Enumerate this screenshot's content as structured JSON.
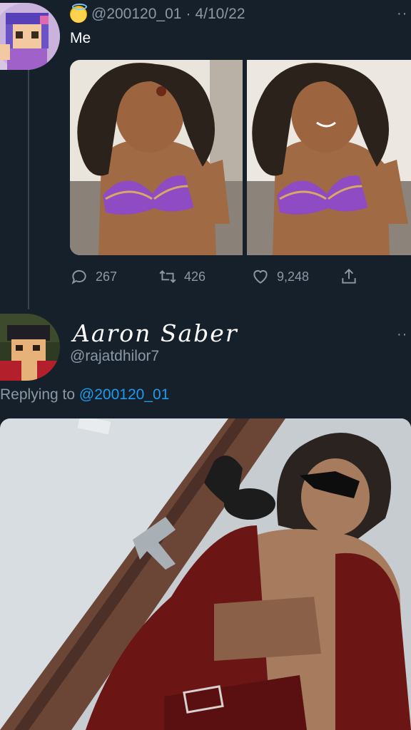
{
  "tweet": {
    "emoji_icon": "smiling-face-with-halo-icon",
    "handle": "@200120_01",
    "separator": "·",
    "date": "4/10/22",
    "text": "Me",
    "more_icon": "more-dots-icon",
    "images": [
      "drawn-character-image-left",
      "drawn-character-image-right"
    ],
    "actions": {
      "reply_count": "267",
      "retweet_count": "426",
      "like_count": "9,248",
      "share_icon": "share-icon"
    }
  },
  "reply": {
    "display_name": "Aaron Saber",
    "handle": "@rajatdhilor7",
    "replying_prefix": "Replying to",
    "replying_to": "@200120_01",
    "image": "drawn-character-photo-composite"
  },
  "colors": {
    "background": "#15202b",
    "secondary_text": "#8b98a5",
    "link": "#1d9bf0",
    "thread_line": "#38444d"
  }
}
